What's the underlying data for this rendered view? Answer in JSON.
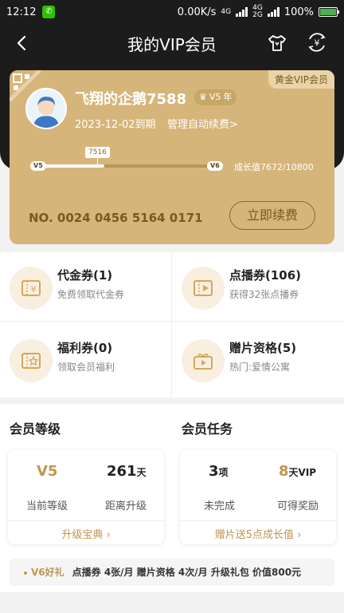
{
  "status_bar": {
    "time": "12:12",
    "network_speed": "0.00K/s",
    "signal_1": "4G",
    "signal_2": "4G",
    "signal_3": "2G",
    "battery": "100%"
  },
  "header": {
    "title": "我的VIP会员"
  },
  "vip_card": {
    "tag": "黄金VIP会员",
    "username": "飞翔的企鹅7588",
    "badge_level": "V5",
    "badge_suffix": "年",
    "expire": "2023-12-02到期",
    "manage_renew": "管理自动续费>",
    "progress_from": "V5",
    "progress_to": "V6",
    "progress_marker": "7516",
    "growth": "成长值7672/10800",
    "progress_fraction": 0.37,
    "card_number": "NO. 0024 0456 5164 0171",
    "renew_button": "立即续费",
    "accent_color": "#d6b57a"
  },
  "coupons": [
    {
      "title": "代金券(1)",
      "subtitle": "免费领取代金券",
      "icon": "yen-ticket-icon"
    },
    {
      "title": "点播券(106)",
      "subtitle": "获得32张点播券",
      "icon": "play-ticket-icon"
    },
    {
      "title": "福利券(0)",
      "subtitle": "领取会员福利",
      "icon": "star-ticket-icon"
    },
    {
      "title": "赠片资格(5)",
      "subtitle": "热门:爱情公寓",
      "icon": "gift-film-icon"
    }
  ],
  "member_level": {
    "title": "会员等级",
    "current_value": "V5",
    "current_label": "当前等级",
    "days_value": "261",
    "days_unit": "天",
    "days_label": "距离升级",
    "link": "升级宝典"
  },
  "member_tasks": {
    "title": "会员任务",
    "pending_value": "3",
    "pending_unit": "项",
    "pending_label": "未完成",
    "reward_value": "8",
    "reward_unit": "天VIP",
    "reward_label": "可得奖励",
    "link": "赠片送5点成长值"
  },
  "benefits": {
    "level": "V6好礼",
    "text": "点播券 4张/月  赠片资格 4次/月  升级礼包 价值800元"
  }
}
